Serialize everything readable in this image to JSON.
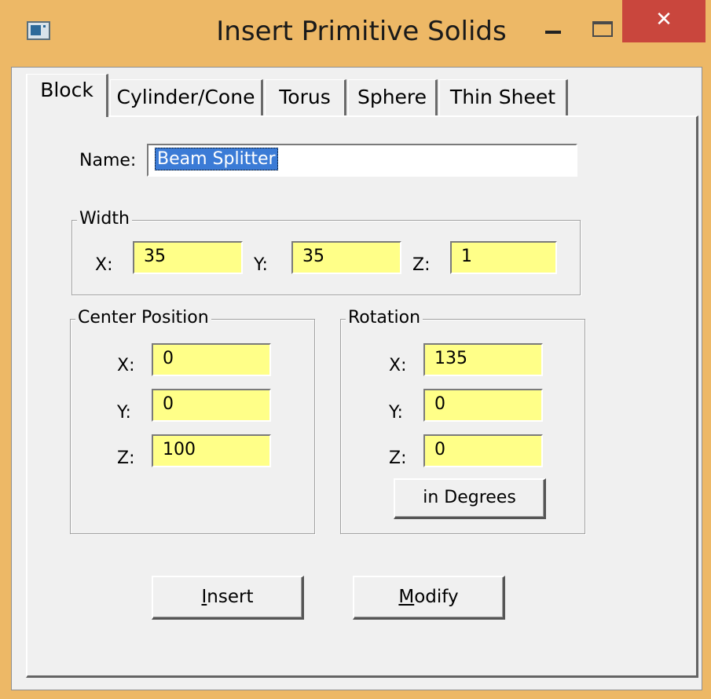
{
  "window": {
    "title": "Insert Primitive Solids",
    "close_glyph": "✕",
    "icons": [
      "app-icon",
      "minimize-icon",
      "maximize-icon",
      "close-icon"
    ]
  },
  "tabs": [
    {
      "label": "Block",
      "active": true
    },
    {
      "label": "Cylinder/Cone",
      "active": false
    },
    {
      "label": "Torus",
      "active": false
    },
    {
      "label": "Sphere",
      "active": false
    },
    {
      "label": "Thin Sheet",
      "active": false
    }
  ],
  "name": {
    "label": "Name:",
    "value": "Beam Splitter",
    "selected": true
  },
  "width": {
    "title": "Width",
    "x_label": "X:",
    "x": "35",
    "y_label": "Y:",
    "y": "35",
    "z_label": "Z:",
    "z": "1"
  },
  "center": {
    "title": "Center Position",
    "x_label": "X:",
    "x": "0",
    "y_label": "Y:",
    "y": "0",
    "z_label": "Z:",
    "z": "100"
  },
  "rotation": {
    "title": "Rotation",
    "x_label": "X:",
    "x": "135",
    "y_label": "Y:",
    "y": "0",
    "z_label": "Z:",
    "z": "0",
    "units_button": "in Degrees"
  },
  "buttons": {
    "insert_mnemonic": "I",
    "insert_rest": "nsert",
    "modify_mnemonic": "M",
    "modify_rest": "odify"
  },
  "colors": {
    "frame": "#edb866",
    "field": "#ffff88",
    "close": "#c9463d",
    "selection": "#3b7bd6"
  }
}
